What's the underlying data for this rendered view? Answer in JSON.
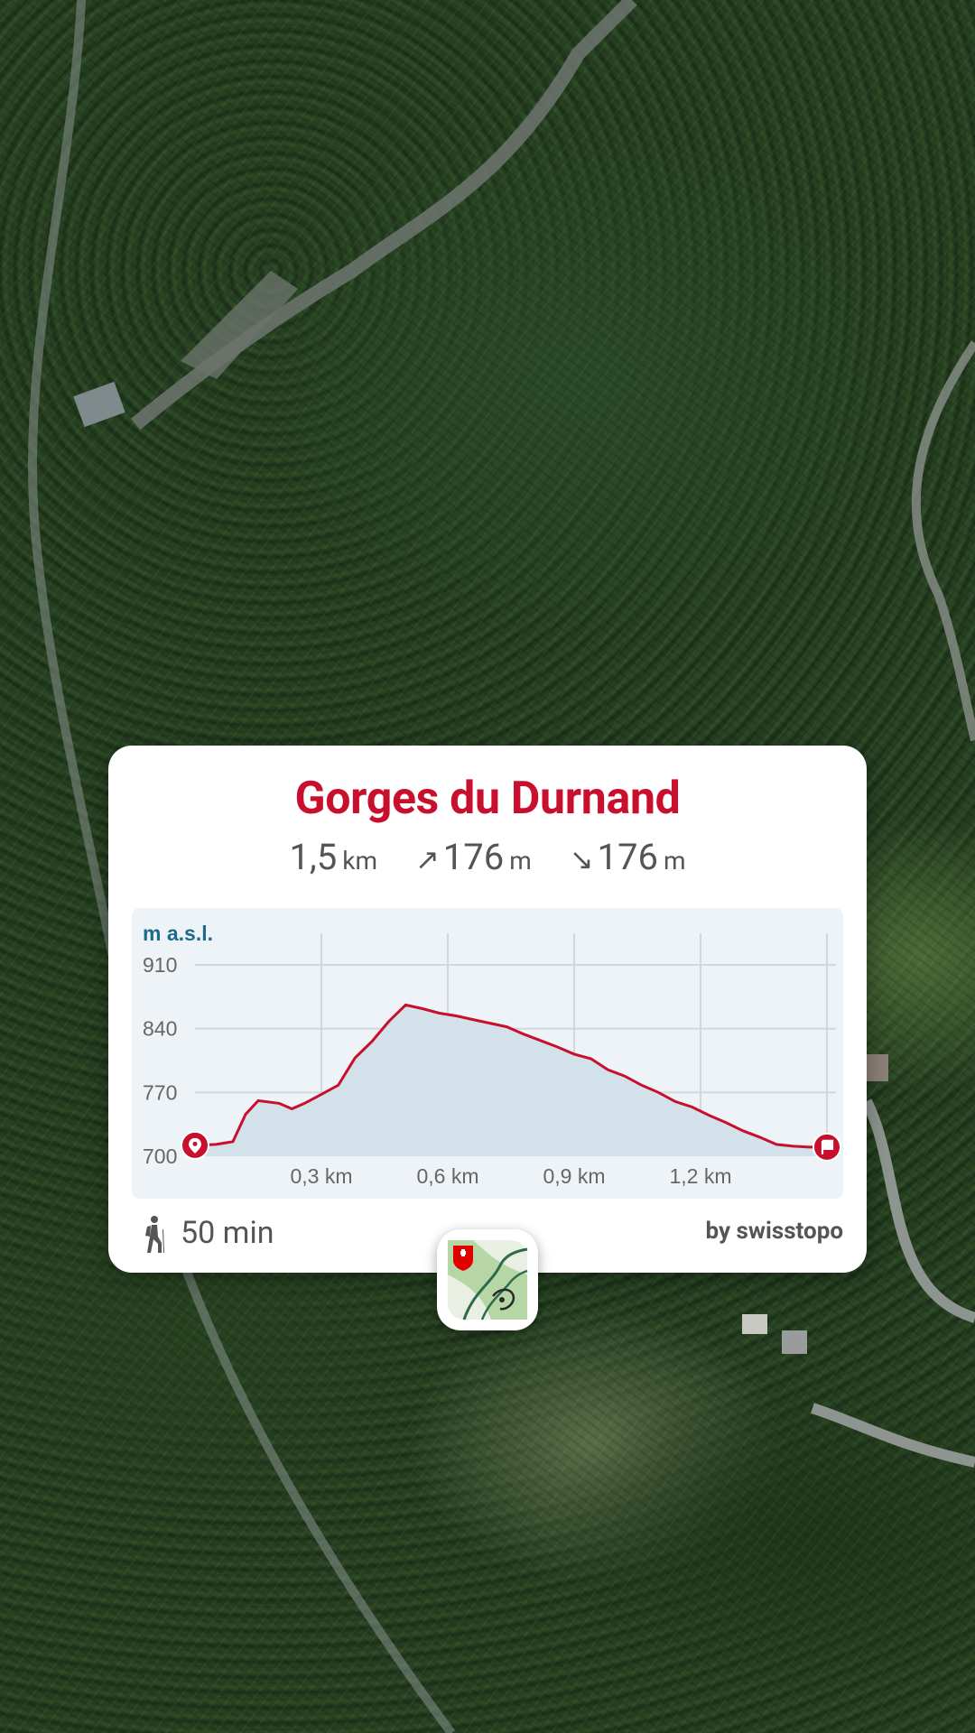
{
  "map": {
    "type": "aerial"
  },
  "route": {
    "title": "Gorges du Durnand",
    "distance": "1,5",
    "distance_unit": "km",
    "ascent": "176",
    "ascent_unit": "m",
    "descent": "176",
    "descent_unit": "m",
    "duration": "50 min",
    "attribution": "by swisstopo"
  },
  "chart_data": {
    "type": "area",
    "ylabel": "m a.s.l.",
    "y_ticks": [
      "910",
      "840",
      "770",
      "700"
    ],
    "x_ticks": [
      "0,3 km",
      "0,6 km",
      "0,9 km",
      "1,2 km"
    ],
    "ylim": [
      700,
      910
    ],
    "xlim": [
      0,
      1.5
    ],
    "x": [
      0,
      0.05,
      0.09,
      0.12,
      0.15,
      0.2,
      0.23,
      0.26,
      0.3,
      0.34,
      0.38,
      0.42,
      0.46,
      0.5,
      0.54,
      0.58,
      0.62,
      0.66,
      0.7,
      0.74,
      0.78,
      0.82,
      0.86,
      0.9,
      0.94,
      0.98,
      1.02,
      1.06,
      1.1,
      1.14,
      1.18,
      1.22,
      1.26,
      1.3,
      1.34,
      1.38,
      1.42,
      1.46,
      1.5
    ],
    "y": [
      712,
      713,
      716,
      746,
      761,
      758,
      752,
      758,
      768,
      778,
      808,
      826,
      848,
      866,
      862,
      857,
      854,
      850,
      846,
      842,
      834,
      827,
      820,
      812,
      807,
      795,
      788,
      778,
      770,
      760,
      754,
      745,
      737,
      728,
      721,
      713,
      711,
      710,
      710
    ],
    "colors": {
      "line": "#c8102e",
      "fill": "#d2e1ea",
      "grid": "#d3d8dc"
    }
  },
  "colors": {
    "accent": "#c8102e",
    "text": "#555555",
    "label": "#1c6a8c"
  },
  "icons": {
    "start": "location-pin-icon",
    "end": "flag-icon",
    "ascent": "arrow-up-right-icon",
    "descent": "arrow-down-right-icon",
    "hiker": "hiker-icon",
    "app": "swisstopo-app-icon"
  }
}
